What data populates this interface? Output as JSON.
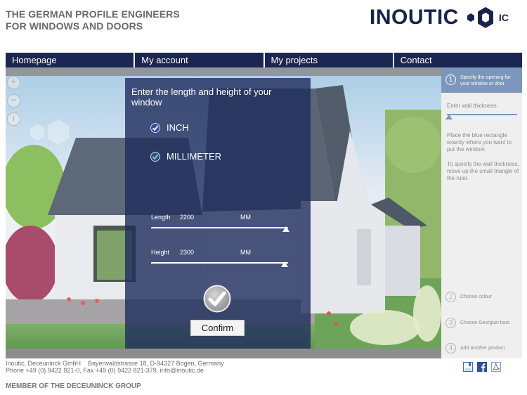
{
  "header": {
    "tagline_line1": "THE GERMAN PROFILE ENGINEERS",
    "tagline_line2": "FOR WINDOWS AND DOORS",
    "logo_text": "INOUTIC",
    "logo_suffix": "IC"
  },
  "nav": {
    "items": [
      {
        "label": "Homepage"
      },
      {
        "label": "My account"
      },
      {
        "label": "My projects"
      },
      {
        "label": "Contact"
      }
    ]
  },
  "map_controls": {
    "zoom_in": "+",
    "zoom_out": "−",
    "info": "i"
  },
  "dialog": {
    "title": "Enter the length and height of your window",
    "units": [
      {
        "label": "INCH",
        "checked": true
      },
      {
        "label": "MILLIMETER",
        "checked": true
      }
    ],
    "length": {
      "label": "Length",
      "value": "2200",
      "unit": "MM"
    },
    "height": {
      "label": "Height",
      "value": "2300",
      "unit": "MM"
    },
    "confirm_label": "Confirm"
  },
  "sidebar": {
    "active_step": {
      "number": "1",
      "text": "Specify the opening for your window or door"
    },
    "wall_label": "Enter wall thickness",
    "wall_thickness_value": 0,
    "instruction_1": "Place the blue rectangle exactly where you want to put the window.",
    "instruction_2": "To specify the wall thickness, move up the small triangle of the ruler.",
    "steps": [
      {
        "number": "2",
        "text": "Choose colour"
      },
      {
        "number": "3",
        "text": "Choose Georgian bars"
      },
      {
        "number": "4",
        "text": "Add another product"
      }
    ]
  },
  "footer": {
    "line1": "Inoutic, Deceuninck GmbH    Bayerwaldstrasse 18, D-94327 Bogen, Germany",
    "line2": "Phone +49 (0) 9422 821-0, Fax +49 (0) 9422 821-379, info@inoutic.de",
    "member": "MEMBER OF THE DECEUNINCK GROUP",
    "share_icons": [
      "save-icon",
      "facebook-icon",
      "pdf-icon"
    ]
  },
  "colors": {
    "brand_navy": "#1b2750",
    "sidebar_accent": "#7c97bb",
    "dialog_overlay": "#1e2c5c"
  }
}
